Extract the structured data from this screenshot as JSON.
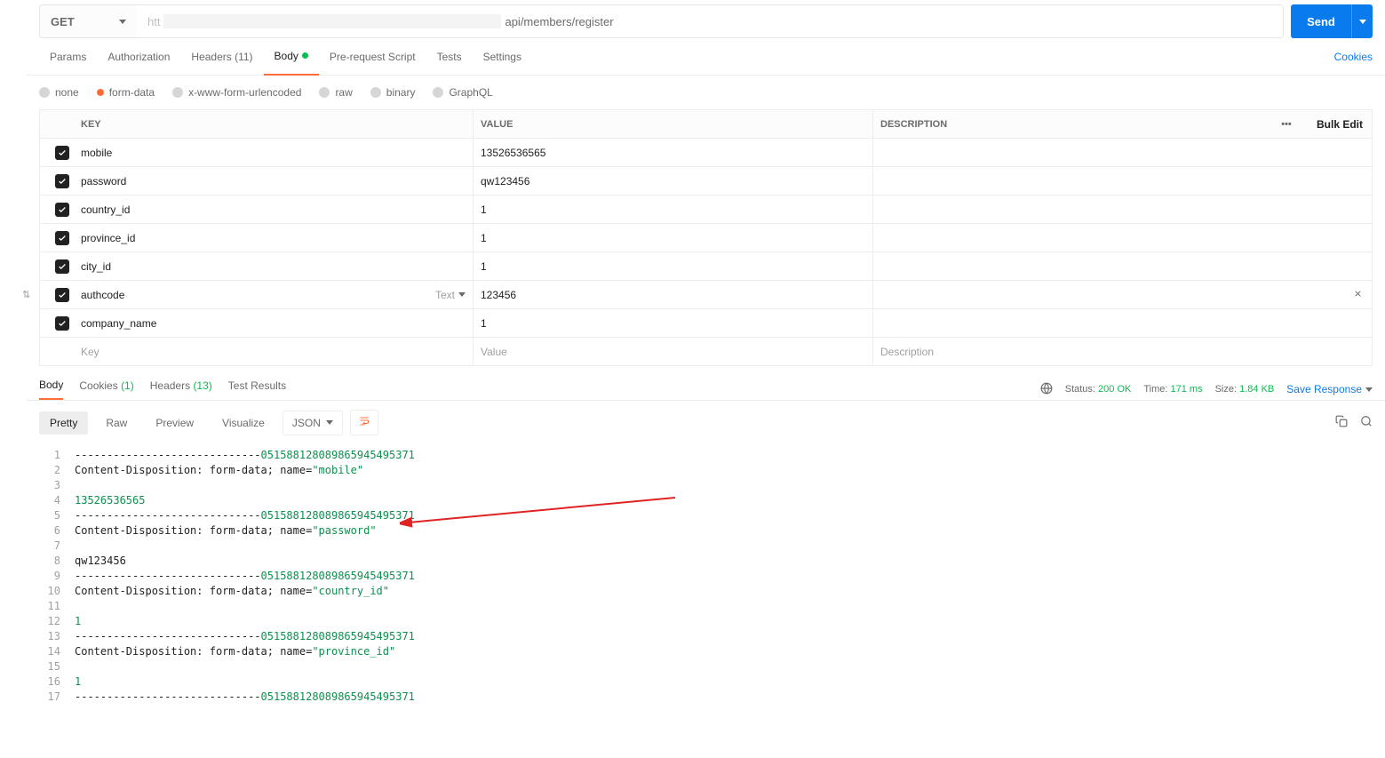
{
  "request": {
    "method": "GET",
    "url_suffix": "api/members/register",
    "send_label": "Send"
  },
  "tabs": {
    "params": "Params",
    "authorization": "Authorization",
    "headers": "Headers",
    "headers_count": "(11)",
    "body": "Body",
    "prerequest": "Pre-request Script",
    "tests": "Tests",
    "settings": "Settings",
    "cookies": "Cookies"
  },
  "body_types": {
    "none": "none",
    "formdata": "form-data",
    "xwww": "x-www-form-urlencoded",
    "raw": "raw",
    "binary": "binary",
    "graphql": "GraphQL"
  },
  "table": {
    "head_key": "KEY",
    "head_value": "VALUE",
    "head_desc": "DESCRIPTION",
    "more": "•••",
    "bulk": "Bulk Edit",
    "placeholder_key": "Key",
    "placeholder_value": "Value",
    "placeholder_desc": "Description",
    "type_text": "Text",
    "rows": [
      {
        "key": "mobile",
        "value": "13526536565"
      },
      {
        "key": "password",
        "value": "qw123456"
      },
      {
        "key": "country_id",
        "value": "1"
      },
      {
        "key": "province_id",
        "value": "1"
      },
      {
        "key": "city_id",
        "value": "1"
      },
      {
        "key": "authcode",
        "value": "123456"
      },
      {
        "key": "company_name",
        "value": "1"
      }
    ]
  },
  "response_tabs": {
    "body": "Body",
    "cookies": "Cookies",
    "cookies_count": "(1)",
    "headers": "Headers",
    "headers_count": "(13)",
    "test_results": "Test Results"
  },
  "status_bar": {
    "status_label": "Status:",
    "status_value": "200 OK",
    "time_label": "Time:",
    "time_value": "171 ms",
    "size_label": "Size:",
    "size_value": "1.84 KB",
    "save": "Save Response"
  },
  "resp_toolbar": {
    "pretty": "Pretty",
    "raw": "Raw",
    "preview": "Preview",
    "visualize": "Visualize",
    "json": "JSON"
  },
  "code": {
    "dashes": "----------------------------",
    "boundary_id": "051588128089865945495371",
    "cd_prefix": "Content-Disposition: form-data; name=",
    "lines": [
      {
        "n": 1,
        "type": "boundary"
      },
      {
        "n": 2,
        "type": "cd",
        "name": "mobile"
      },
      {
        "n": 3,
        "type": "blank"
      },
      {
        "n": 4,
        "type": "value_green",
        "value": "13526536565"
      },
      {
        "n": 5,
        "type": "boundary"
      },
      {
        "n": 6,
        "type": "cd",
        "name": "password"
      },
      {
        "n": 7,
        "type": "blank"
      },
      {
        "n": 8,
        "type": "value",
        "value": "qw123456"
      },
      {
        "n": 9,
        "type": "boundary"
      },
      {
        "n": 10,
        "type": "cd",
        "name": "country_id"
      },
      {
        "n": 11,
        "type": "blank"
      },
      {
        "n": 12,
        "type": "value_green",
        "value": "1"
      },
      {
        "n": 13,
        "type": "boundary"
      },
      {
        "n": 14,
        "type": "cd",
        "name": "province_id"
      },
      {
        "n": 15,
        "type": "blank"
      },
      {
        "n": 16,
        "type": "value_green",
        "value": "1"
      },
      {
        "n": 17,
        "type": "boundary"
      }
    ]
  }
}
